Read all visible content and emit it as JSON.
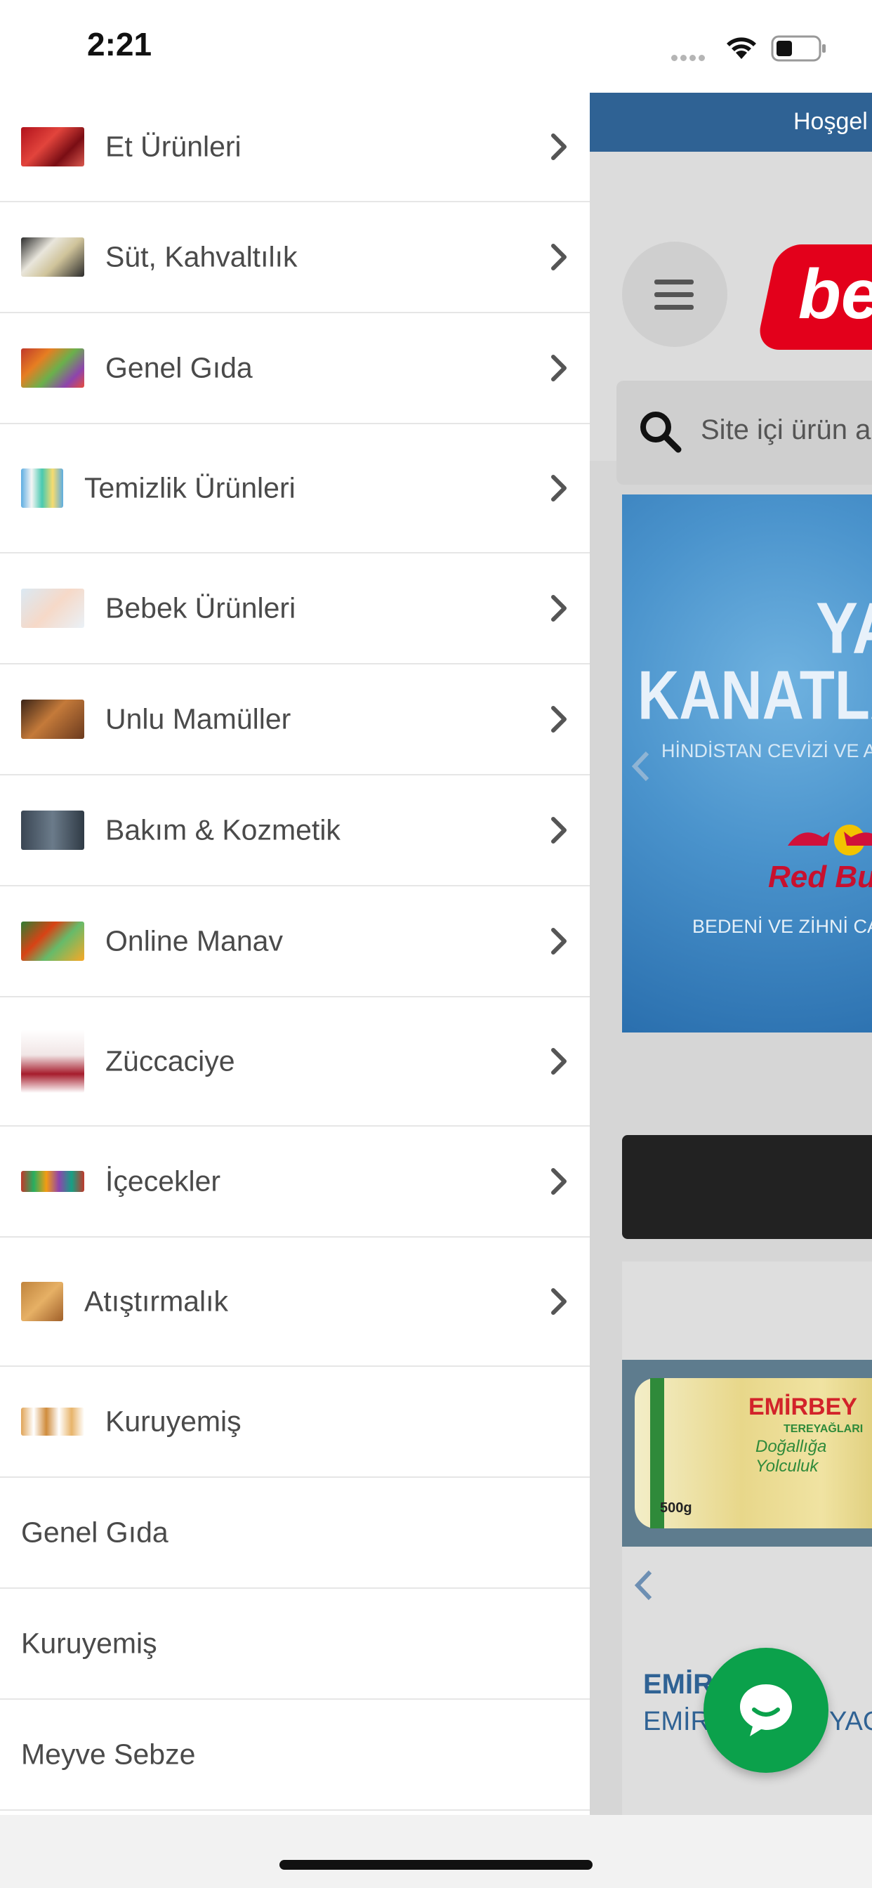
{
  "status_bar": {
    "time": "2:21"
  },
  "drawer": {
    "categories": [
      {
        "label": "Et Ürünleri",
        "icon": "meat-thumbnail-icon",
        "has_children": true
      },
      {
        "label": "Süt, Kahvaltılık",
        "icon": "breakfast-thumbnail-icon",
        "has_children": true
      },
      {
        "label": "Genel Gıda",
        "icon": "grocery-thumbnail-icon",
        "has_children": true
      },
      {
        "label": "Temizlik Ürünleri",
        "icon": "cleaning-thumbnail-icon",
        "has_children": true
      },
      {
        "label": "Bebek Ürünleri",
        "icon": "baby-thumbnail-icon",
        "has_children": true
      },
      {
        "label": "Unlu Mamüller",
        "icon": "bakery-thumbnail-icon",
        "has_children": true
      },
      {
        "label": "Bakım & Kozmetik",
        "icon": "cosmetics-thumbnail-icon",
        "has_children": true
      },
      {
        "label": "Online Manav",
        "icon": "vegetables-thumbnail-icon",
        "has_children": true
      },
      {
        "label": "Züccaciye",
        "icon": "glassware-thumbnail-icon",
        "has_children": true
      },
      {
        "label": "İçecekler",
        "icon": "drinks-thumbnail-icon",
        "has_children": true
      },
      {
        "label": "Atıştırmalık",
        "icon": "snacks-thumbnail-icon",
        "has_children": true
      },
      {
        "label": "Kuruyemiş",
        "icon": "nuts-thumbnail-icon",
        "has_children": false
      }
    ],
    "links": [
      {
        "label": "Genel Gıda"
      },
      {
        "label": "Kuruyemiş"
      },
      {
        "label": "Meyve Sebze"
      }
    ]
  },
  "site": {
    "welcome": "Hoşgel",
    "logo_text": "be",
    "search_placeholder": "Site içi ürün a",
    "banner": {
      "headline_1": "YAZ",
      "headline_2": "KANATLAN",
      "subtitle": "HİNDİSTAN CEVİZİ VE AÇ",
      "brand": "Red Bu",
      "tagline": "BEDENİ VE ZİHNİ CA"
    },
    "product": {
      "pack_brand": "EMİRBEY",
      "pack_sub": "TEREYAĞLARI",
      "pack_slogan": "Doğallığa Yolculuk",
      "pack_weight": "500g",
      "title": "EMİR",
      "subtitle_left": "EMİR",
      "subtitle_right": "YAG"
    }
  },
  "colors": {
    "welcome_bar": "#2f6294",
    "chat_button": "#0ba14b",
    "logo_red": "#e3001b"
  }
}
